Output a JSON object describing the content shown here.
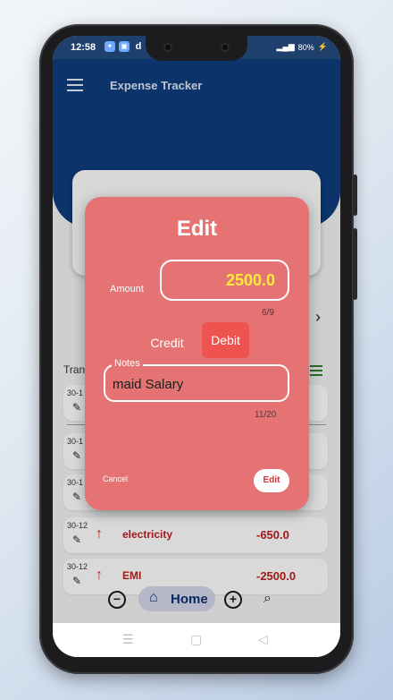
{
  "status_bar": {
    "time": "12:58",
    "app_icons": [
      "app-icon",
      "app-icon",
      "d"
    ],
    "right_text": "80%"
  },
  "app": {
    "title": "Expense Tracker",
    "transactions_label": "Tran",
    "rows": [
      {
        "date": "30-1",
        "name": "",
        "amount": ""
      },
      {
        "date": "30-1",
        "name": "",
        "amount": ""
      },
      {
        "date": "30-1",
        "name": "",
        "amount": ""
      },
      {
        "date": "30-12",
        "name": "electricity",
        "amount": "-650.0"
      },
      {
        "date": "30-12",
        "name": "EMI",
        "amount": "-2500.0"
      }
    ]
  },
  "nav": {
    "home_label": "Home"
  },
  "dialog": {
    "title": "Edit",
    "amount_label": "Amount",
    "amount_value": "2500.0",
    "amount_counter": "6/9",
    "credit_label": "Credit",
    "debit_label": "Debit",
    "notes_label": "Notes",
    "notes_value": "maid Salary",
    "notes_counter": "11/20",
    "cancel_label": "Cancel",
    "edit_label": "Edit"
  },
  "colors": {
    "dialog_bg": "#e57373",
    "debit_selected": "#ef5350",
    "amount_text": "#ffeb3b",
    "header_bg": "#0e3c7a"
  }
}
